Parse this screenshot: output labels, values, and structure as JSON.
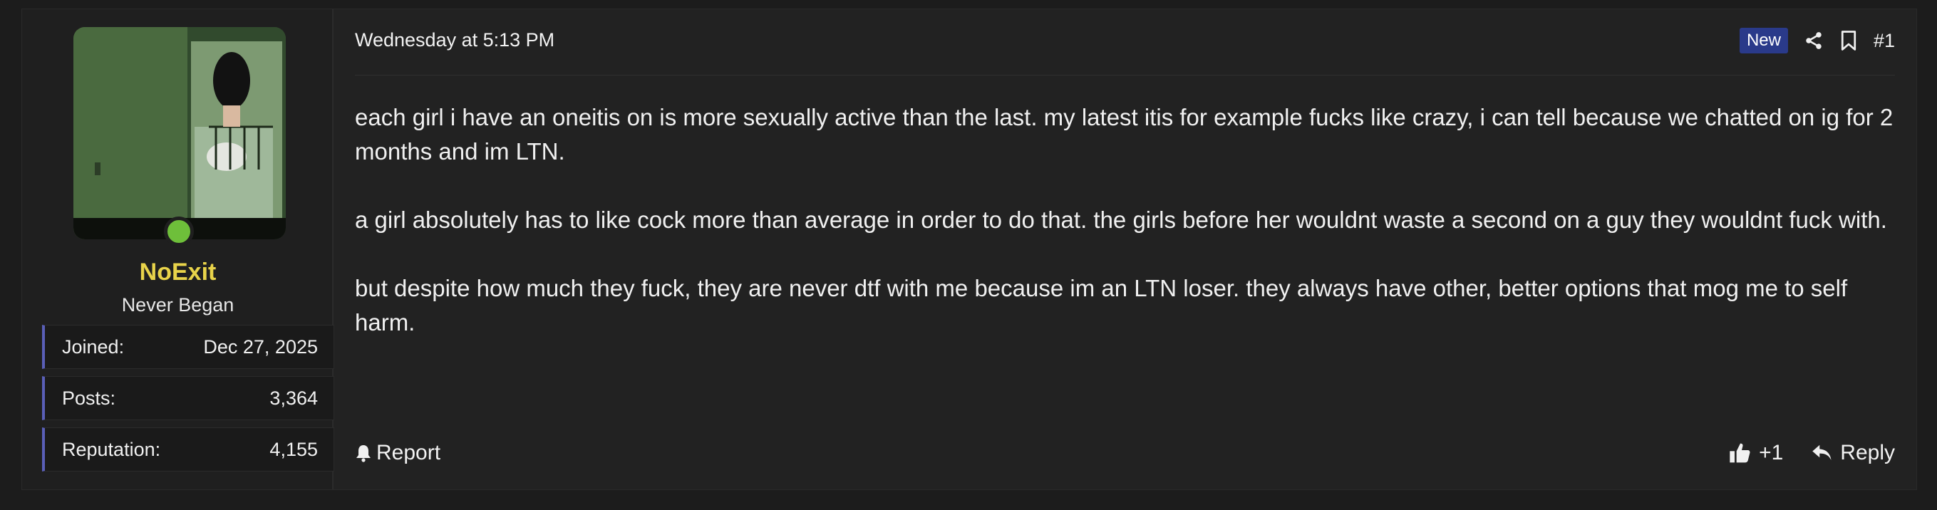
{
  "user": {
    "username": "NoExit",
    "title": "Never Began",
    "stats": [
      {
        "label": "Joined:",
        "value": "Dec 27, 2025"
      },
      {
        "label": "Posts:",
        "value": "3,364"
      },
      {
        "label": "Reputation:",
        "value": "4,155"
      }
    ],
    "online_color": "#6ebf3a",
    "name_color": "#e8d34a"
  },
  "post": {
    "timestamp": "Wednesday at 5:13 PM",
    "badge": "New",
    "number": "#1",
    "paragraphs": [
      "each girl i have an oneitis on is more sexually active than the last. my latest itis for example fucks like crazy, i can tell because we chatted on ig for 2 months and im LTN.",
      "a girl absolutely has to like cock more than average in order to do that. the girls before her wouldnt waste a second on a guy they wouldnt fuck with.",
      "but despite how much they fuck, they are never dtf with me because im an LTN loser. they always have other, better options that mog me to self harm."
    ]
  },
  "actions": {
    "report": "Report",
    "like_count": "+1",
    "reply": "Reply"
  },
  "icons": {
    "share": "share-icon",
    "bookmark": "bookmark-icon",
    "bell": "bell-icon",
    "thumbs_up": "thumbs-up-icon",
    "reply": "reply-icon"
  }
}
